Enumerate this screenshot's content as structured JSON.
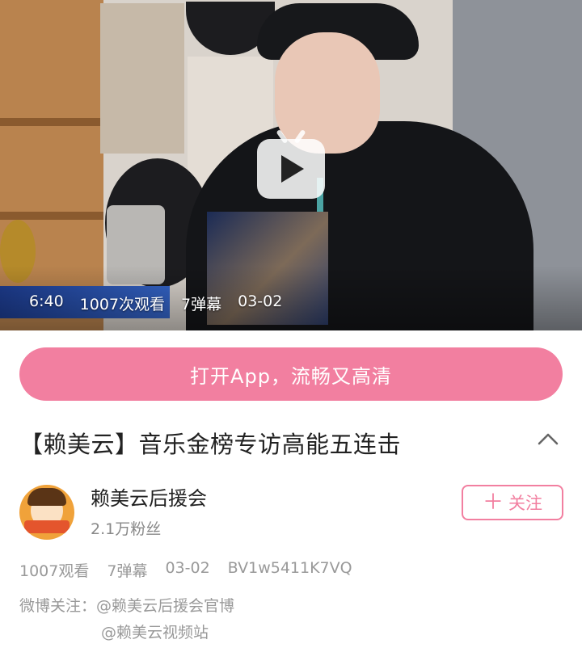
{
  "video": {
    "duration": "6:40",
    "views": "1007次观看",
    "danmaku": "7弹幕",
    "date": "03-02"
  },
  "open_app_label": "打开App，流畅又高清",
  "title": "【赖美云】音乐金榜专访高能五连击",
  "uploader": {
    "name": "赖美云后援会",
    "fans": "2.1万粉丝",
    "follow_label": "关注"
  },
  "stats": {
    "views": "1007观看",
    "danmaku": "7弹幕",
    "date": "03-02",
    "bvid": "BV1w5411K7VQ"
  },
  "description": {
    "line1": "微博关注：@赖美云后援会官博",
    "line2": "@赖美云视频站"
  },
  "colors": {
    "accent_pink": "#f27fa0",
    "muted_text": "#999999"
  },
  "icons": [
    "bilibili-play-icon",
    "chevron-up-icon",
    "plus-icon"
  ]
}
